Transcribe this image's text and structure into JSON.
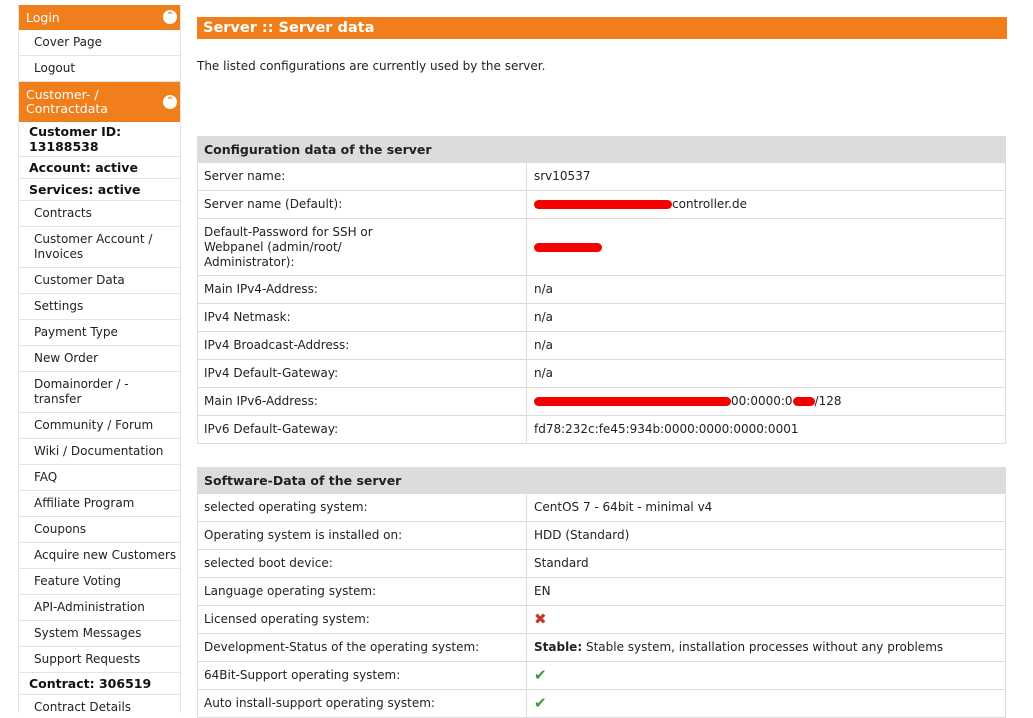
{
  "sidebar": {
    "login_header": "Login",
    "cover_page": "Cover Page",
    "logout": "Logout",
    "customer_header": "Customer- / Contractdata",
    "customer_id": "Customer ID: 13188538",
    "account": "Account: active",
    "services": "Services: active",
    "contracts": "Contracts",
    "customer_account": "Customer Account / Invoices",
    "customer_data": "Customer Data",
    "settings": "Settings",
    "payment_type": "Payment Type",
    "new_order": "New Order",
    "domainorder": "Domainorder / - transfer",
    "community": "Community / Forum",
    "wiki": "Wiki / Documentation",
    "faq": "FAQ",
    "affiliate": "Affiliate Program",
    "coupons": "Coupons",
    "acquire": "Acquire new Customers",
    "feature_voting": "Feature Voting",
    "api_admin": "API-Administration",
    "system_messages": "System Messages",
    "support_requests": "Support Requests",
    "contract": "Contract: 306519",
    "contract_details": "Contract Details",
    "collapse_icon": "chevron-up-circle-icon"
  },
  "main": {
    "title": "Server :: Server data",
    "intro": "The listed configurations are currently used by the server.",
    "config": {
      "header": "Configuration data of the server",
      "server_name_label": "Server name:",
      "server_name_value": "srv10537",
      "server_name_default_label": "Server name (Default):",
      "server_name_default_suffix": "controller.de",
      "password_label": "Default-Password for SSH or Webpanel (admin/root/ Administrator):",
      "ipv4_label": "Main IPv4-Address:",
      "ipv4_value": "n/a",
      "netmask_label": "IPv4 Netmask:",
      "netmask_value": "n/a",
      "broadcast_label": "IPv4 Broadcast-Address:",
      "broadcast_value": "n/a",
      "gateway_label": "IPv4 Default-Gateway:",
      "gateway_value": "n/a",
      "ipv6_label": "Main IPv6-Address:",
      "ipv6_part1": "00:0000:0",
      "ipv6_part2": "/128",
      "ipv6_gateway_label": "IPv6 Default-Gateway:",
      "ipv6_gateway_value": "fd78:232c:fe45:934b:0000:0000:0000:0001"
    },
    "software": {
      "header": "Software-Data of the server",
      "os_label": "selected operating system:",
      "os_value": "CentOS 7 - 64bit - minimal v4",
      "installed_label": "Operating system is installed on:",
      "installed_value": "HDD (Standard)",
      "boot_label": "selected boot device:",
      "boot_value": "Standard",
      "lang_label": "Language operating system:",
      "lang_value": "EN",
      "licensed_label": "Licensed operating system:",
      "licensed_icon": "cross-icon",
      "devstatus_label": "Development-Status of the operating system:",
      "devstatus_strong": "Stable:",
      "devstatus_text": "Stable system, installation processes without any problems",
      "bit64_label": "64Bit-Support operating system:",
      "bit64_icon": "checkmark-icon",
      "autoinstall_label": "Auto install-support operating system:",
      "autoinstall_icon": "checkmark-icon"
    }
  },
  "colors": {
    "accent": "#f07e1b",
    "section_header_bg": "#dcdcdc",
    "redaction": "#f40000",
    "check": "#3c9a3c",
    "cross": "#c0392b"
  }
}
